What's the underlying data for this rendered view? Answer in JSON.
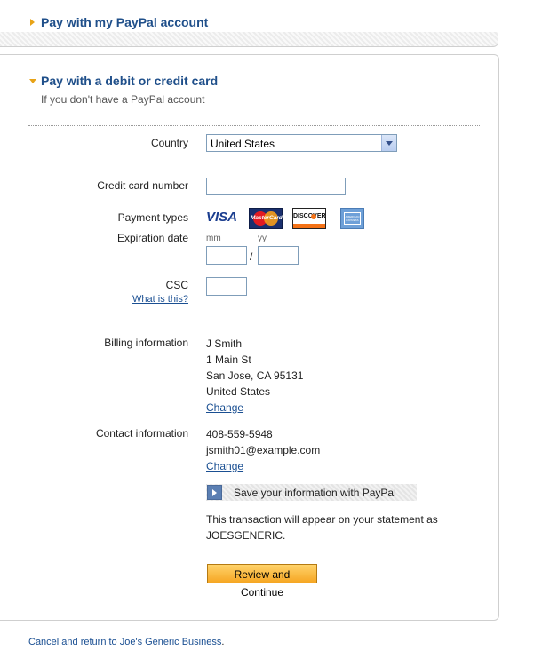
{
  "paypal_section": {
    "title": "Pay with my PayPal account"
  },
  "card_section": {
    "title": "Pay with a debit or credit card",
    "subtitle": "If you don't have a PayPal account"
  },
  "form": {
    "country_label": "Country",
    "country_value": "United States",
    "card_number_label": "Credit card number",
    "card_number_value": "",
    "payment_types_label": "Payment types",
    "payment_types": [
      "VISA",
      "MasterCard",
      "DISCOVER",
      "AMERICAN EXPRESS"
    ],
    "expiration_label": "Expiration date",
    "exp_mm_hint": "mm",
    "exp_yy_hint": "yy",
    "exp_separator": "/",
    "csc_label": "CSC",
    "csc_help_link": "What is this?",
    "billing_label": "Billing information",
    "billing_lines": [
      "J Smith",
      "1 Main St",
      "San Jose, CA 95131",
      "United States"
    ],
    "billing_change": "Change",
    "contact_label": "Contact information",
    "contact_phone": "408-559-5948",
    "contact_email": "jsmith01@example.com",
    "contact_change": "Change",
    "save_info_label": "Save your information with PayPal",
    "statement_line1": "This transaction will appear on your statement as",
    "statement_line2": "JOESGENERIC.",
    "submit_label": "Review and Continue"
  },
  "footer": {
    "cancel_link": "Cancel and return to Joe's Generic Business",
    "cancel_suffix": "."
  },
  "colors": {
    "title_blue": "#1f4f8a",
    "link_blue": "#1a4f92",
    "accent_orange": "#e8a317",
    "button_orange": "#f6a623"
  }
}
